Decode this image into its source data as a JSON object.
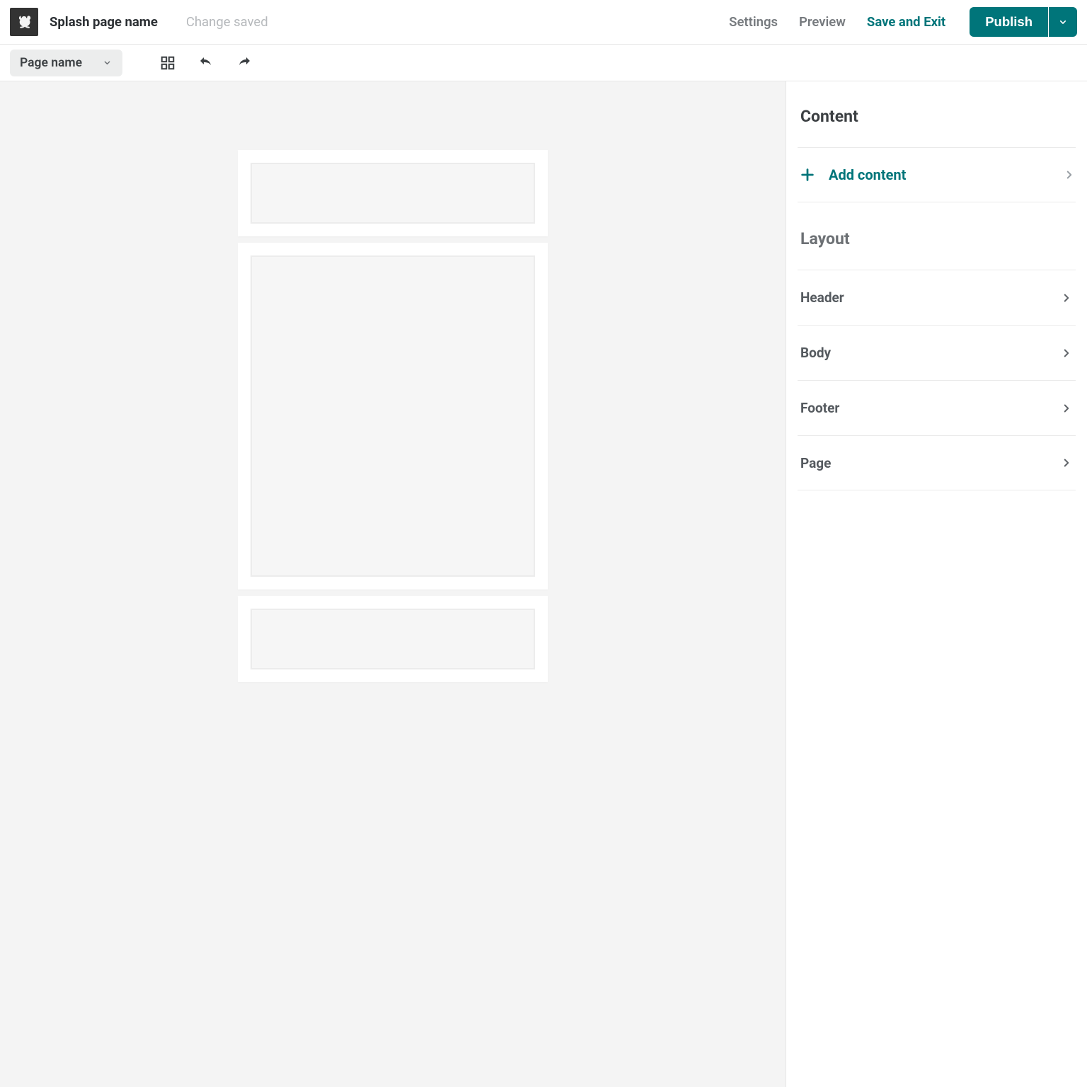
{
  "topbar": {
    "page_title": "Splash page name",
    "status": "Change saved",
    "settings": "Settings",
    "preview": "Preview",
    "save_exit": "Save and Exit",
    "publish": "Publish"
  },
  "toolbar": {
    "page_select": "Page name"
  },
  "sidebar": {
    "content_title": "Content",
    "add_content": "Add content",
    "layout_title": "Layout",
    "rows": {
      "header": "Header",
      "body": "Body",
      "footer": "Footer",
      "page": "Page"
    }
  },
  "colors": {
    "accent": "#00757a"
  }
}
